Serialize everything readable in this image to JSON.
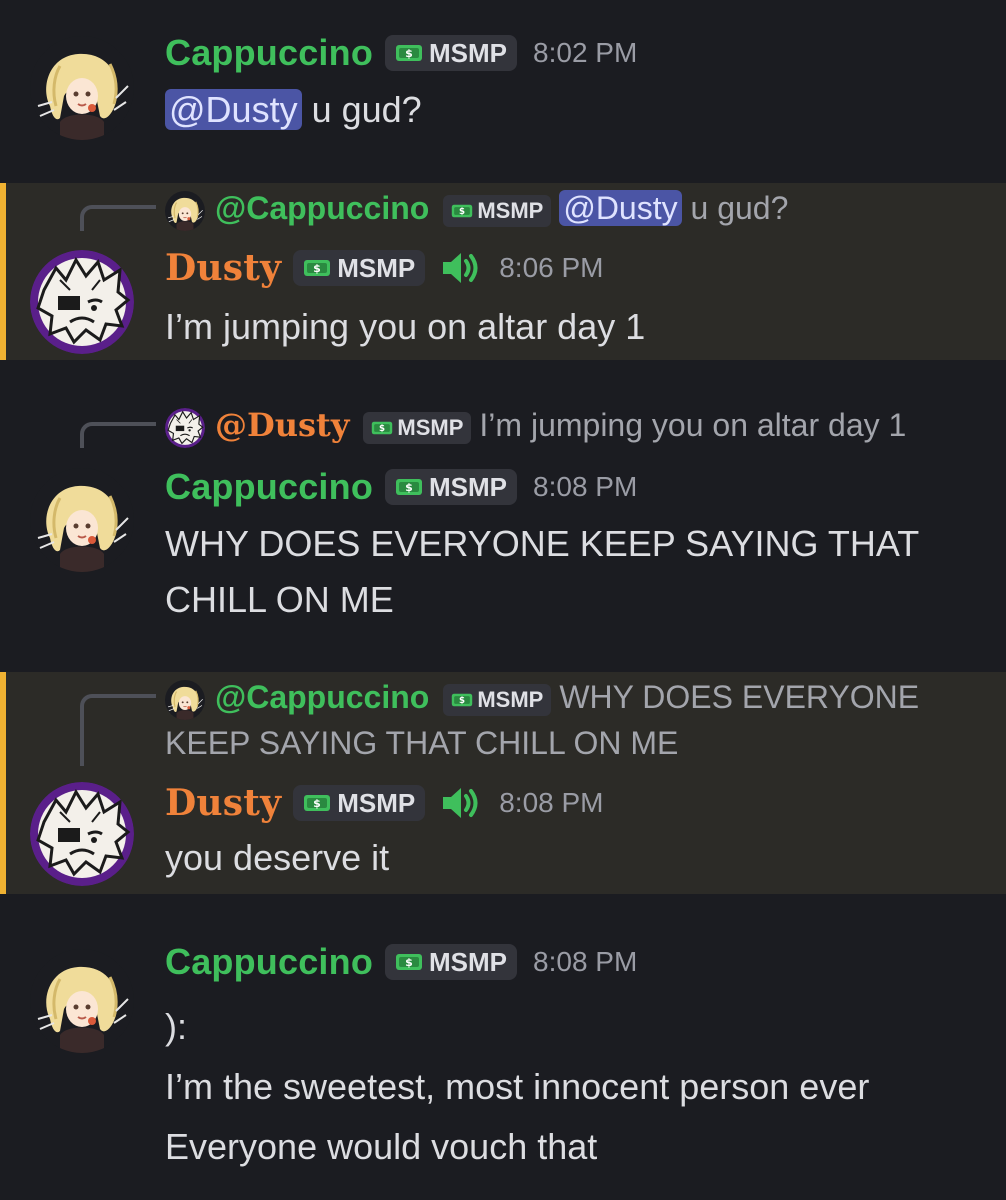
{
  "tag_label": "MSMP",
  "colors": {
    "background": "#1b1c21",
    "mentioned_background": "#2c2b27",
    "mentioned_bar": "#f0b232",
    "cappuccino": "#3fbf5c",
    "dusty": "#f0823a",
    "mention_pill": "#4b55a5",
    "timestamp": "#9a9ca5"
  },
  "icons": {
    "tag": "money-icon",
    "voice": "speaker-icon"
  },
  "messages": [
    {
      "author": "Cappuccino",
      "time": "8:02 PM",
      "mention": "@Dusty",
      "text": "u gud?"
    },
    {
      "reply": {
        "author": "@Cappuccino",
        "mention": "@Dusty",
        "text": "u gud?"
      },
      "author": "Dusty",
      "time": "8:06 PM",
      "text": "I’m jumping you on altar day 1"
    },
    {
      "reply": {
        "author": "@Dusty",
        "text": "I’m jumping you on altar day 1"
      },
      "author": "Cappuccino",
      "time": "8:08 PM",
      "text_lines": [
        "WHY DOES EVERYONE KEEP SAYING THAT",
        "CHILL ON ME"
      ]
    },
    {
      "reply": {
        "author": "@Cappuccino",
        "text_first": "WHY DOES EVERYONE",
        "text_second": "KEEP SAYING THAT CHILL ON ME"
      },
      "author": "Dusty",
      "time": "8:08 PM",
      "text": "you deserve it"
    },
    {
      "author": "Cappuccino",
      "time": "8:08 PM",
      "text_lines": [
        "):",
        "I’m the sweetest, most innocent person ever",
        "Everyone would vouch that"
      ]
    }
  ]
}
